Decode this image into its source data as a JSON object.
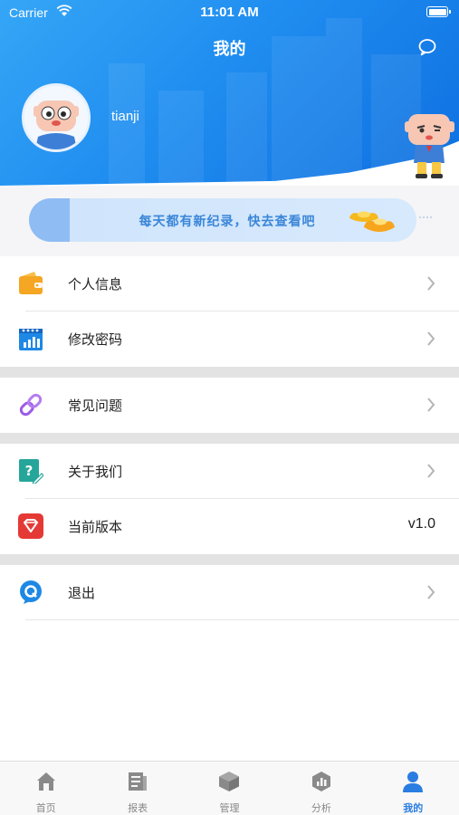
{
  "status_bar": {
    "carrier": "Carrier",
    "time": "11:01 AM"
  },
  "header": {
    "title": "我的",
    "username": "tianji"
  },
  "banner": {
    "text": "每天都有新纪录，快去查看吧"
  },
  "menu": [
    {
      "label": "个人信息",
      "icon": "wallet-icon",
      "color": "#f5a623"
    },
    {
      "label": "修改密码",
      "icon": "calendar-chart-icon",
      "color": "#1e88e5"
    },
    {
      "label": "常见问题",
      "icon": "link-icon",
      "color": "#9c5ce6"
    },
    {
      "label": "关于我们",
      "icon": "question-edit-icon",
      "color": "#26a69a"
    },
    {
      "label": "当前版本",
      "icon": "diamond-icon",
      "color": "#e53935",
      "value": "v1.0"
    },
    {
      "label": "退出",
      "icon": "q-chat-icon",
      "color": "#1e88e5"
    }
  ],
  "tabs": [
    {
      "label": "首页",
      "icon": "home-icon"
    },
    {
      "label": "报表",
      "icon": "report-icon"
    },
    {
      "label": "管理",
      "icon": "cube-icon"
    },
    {
      "label": "分析",
      "icon": "analysis-icon"
    },
    {
      "label": "我的",
      "icon": "user-icon",
      "active": true
    }
  ],
  "colors": {
    "accent": "#2a7de1",
    "header": "#1f8df0"
  }
}
